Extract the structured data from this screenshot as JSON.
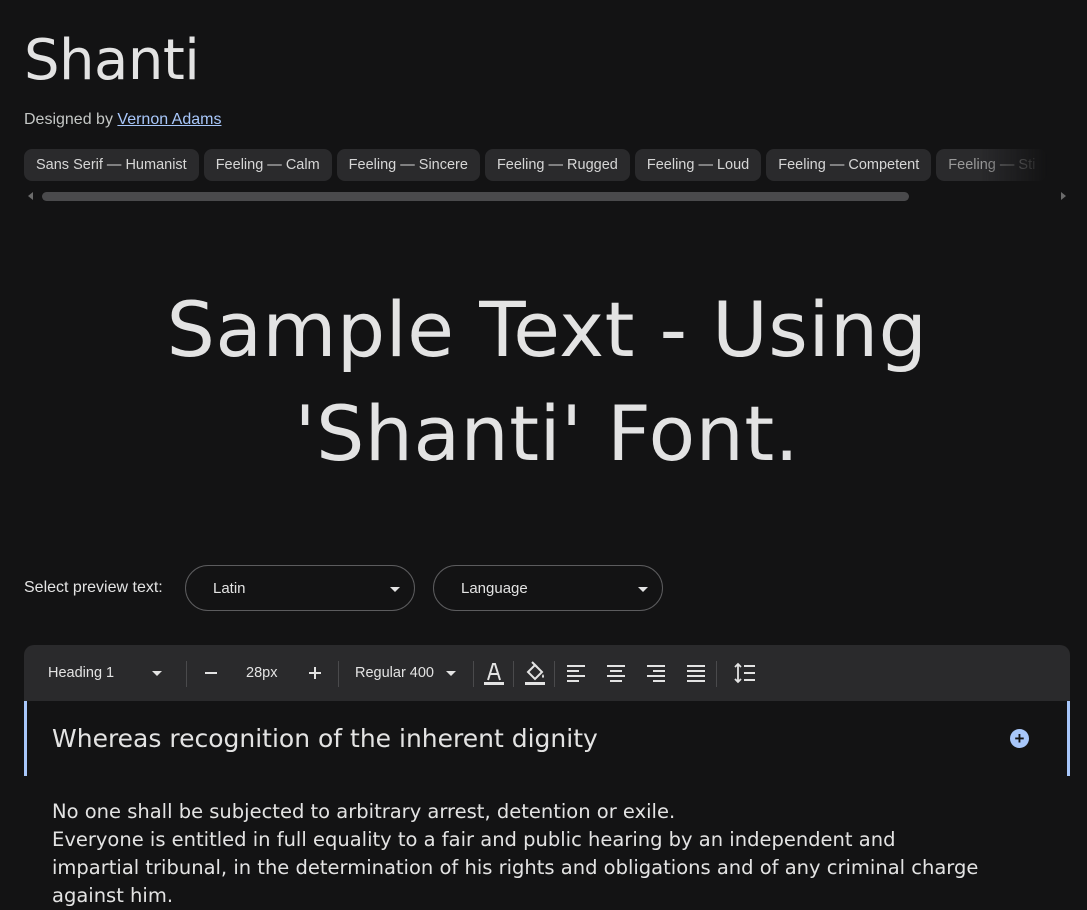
{
  "font": {
    "name": "Shanti",
    "designed_by_label": "Designed by",
    "designer": "Vernon Adams"
  },
  "tags": [
    "Sans Serif — Humanist",
    "Feeling — Calm",
    "Feeling — Sincere",
    "Feeling — Rugged",
    "Feeling — Loud",
    "Feeling — Competent",
    "Feeling — Sti"
  ],
  "sample_text": "Sample Text - Using 'Shanti' Font.",
  "preview": {
    "label": "Select preview text:",
    "script_value": "Latin",
    "language_value": "Language"
  },
  "toolbar": {
    "style_value": "Heading 1",
    "size_value": "28px",
    "weight_value": "Regular 400"
  },
  "editor": {
    "heading": "Whereas recognition of the inherent dignity",
    "paragraph_lines": [
      "No one shall be subjected to arbitrary arrest, detention or exile.",
      "Everyone is entitled in full equality to a fair and public hearing by an independent and",
      "impartial tribunal, in the determination of his rights and obligations and of any criminal charge",
      "against him."
    ]
  },
  "colors": {
    "background": "#131314",
    "accent": "#a8c7fa",
    "toolbar": "#2a2a2c"
  }
}
